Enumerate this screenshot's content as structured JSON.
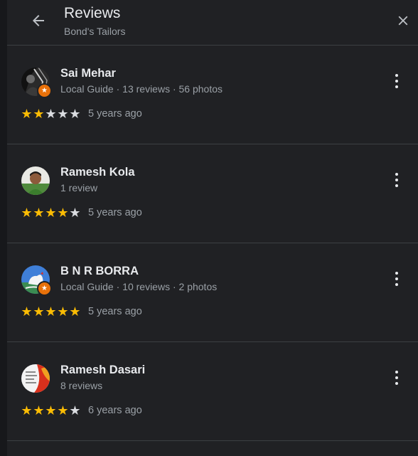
{
  "header": {
    "title": "Reviews",
    "subtitle": "Bond's Tailors",
    "back_icon": "arrow-back-icon",
    "close_icon": "close-icon"
  },
  "reviews": [
    {
      "name": "Sai Mehar",
      "meta": "Local Guide · 13 reviews · 56 photos",
      "rating": 2,
      "date": "5 years ago",
      "local_guide_badge": true
    },
    {
      "name": "Ramesh Kola",
      "meta": "1 review",
      "rating": 4,
      "date": "5 years ago",
      "local_guide_badge": false
    },
    {
      "name": "B N R BORRA",
      "meta": "Local Guide · 10 reviews · 2 photos",
      "rating": 5,
      "date": "5 years ago",
      "local_guide_badge": true
    },
    {
      "name": "Ramesh Dasari",
      "meta": "8 reviews",
      "rating": 4,
      "date": "6 years ago",
      "local_guide_badge": false
    }
  ],
  "colors": {
    "background": "#202124",
    "star_filled": "#fbbc04",
    "star_empty": "#dadce0",
    "badge": "#e8710a"
  }
}
